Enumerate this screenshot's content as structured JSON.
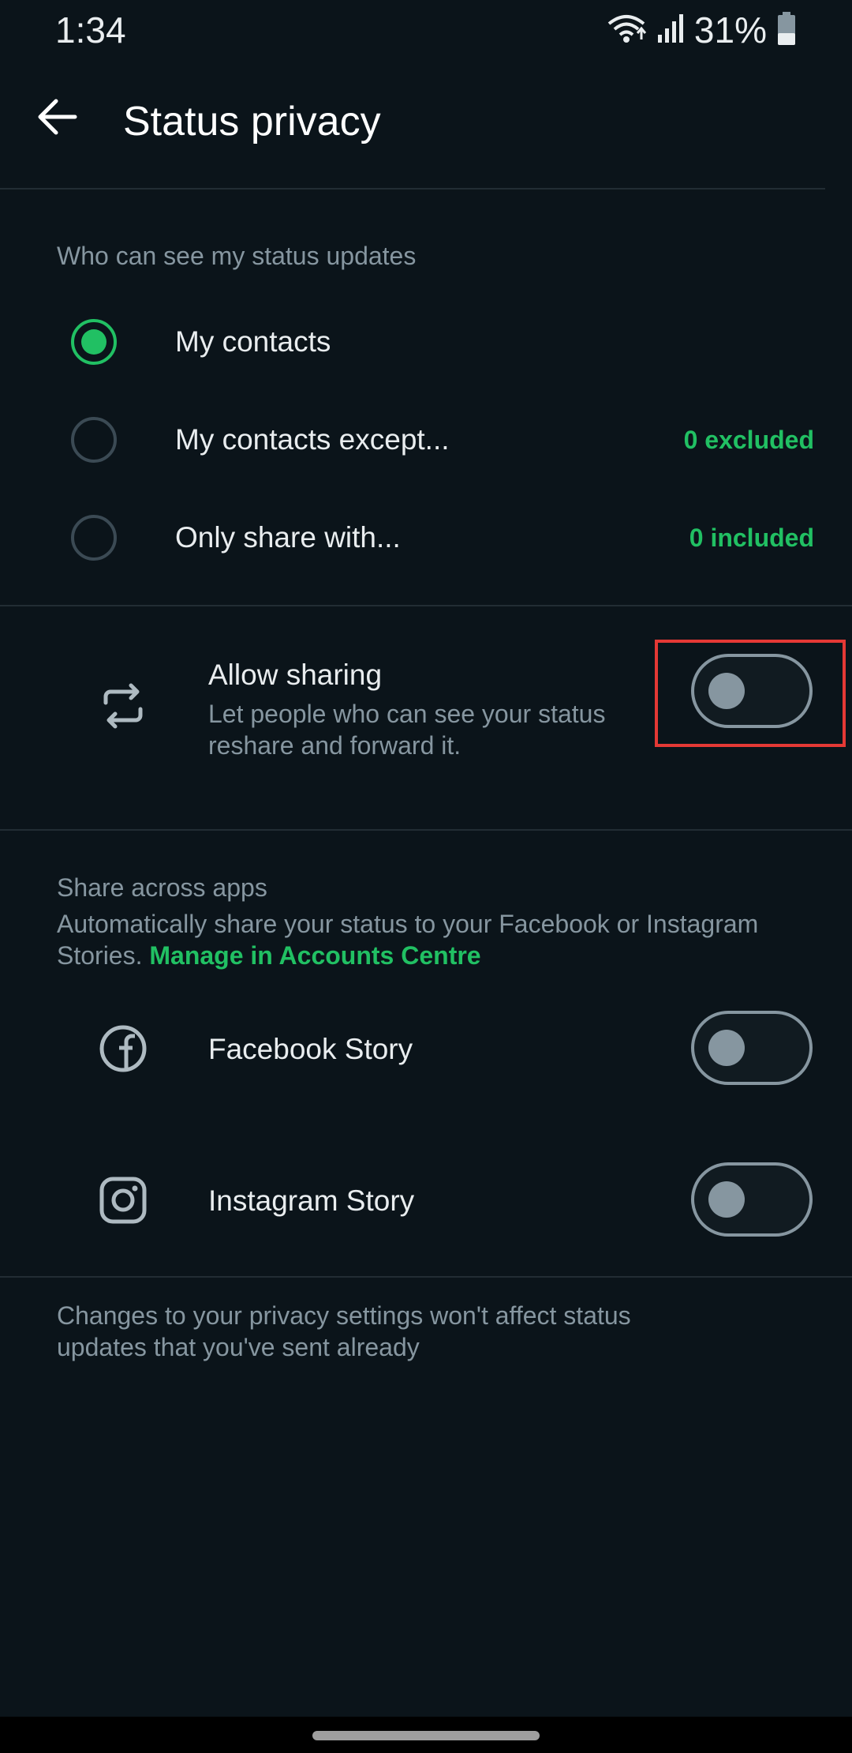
{
  "status_bar": {
    "time": "1:34",
    "battery_pct": "31%",
    "icons": [
      "wifi-icon",
      "signal-icon",
      "battery-icon"
    ]
  },
  "app_bar": {
    "title": "Status privacy",
    "back_icon": "arrow-left-icon"
  },
  "audience": {
    "section_title": "Who can see my status updates",
    "options": [
      {
        "label": "My contacts",
        "count": "",
        "selected": true
      },
      {
        "label": "My contacts except...",
        "count": "0 excluded",
        "selected": false
      },
      {
        "label": "Only share with...",
        "count": "0 included",
        "selected": false
      }
    ]
  },
  "allow_sharing": {
    "icon": "repeat-icon",
    "title": "Allow sharing",
    "subtitle_line1": "Let people who can see your status",
    "subtitle_line2": "reshare and forward it.",
    "enabled": false
  },
  "share_across_apps": {
    "section_title": "Share across apps",
    "desc_line1": "Automatically share your status to your Facebook or Instagram",
    "desc_line2": "Stories.",
    "link": "Manage in Accounts Centre",
    "items": [
      {
        "icon": "facebook-icon",
        "label": "Facebook Story",
        "enabled": false
      },
      {
        "icon": "instagram-icon",
        "label": "Instagram Story",
        "enabled": false
      }
    ]
  },
  "footer": {
    "note_line1": "Changes to your privacy settings won't affect status",
    "note_line2": "updates that you've sent already"
  },
  "colors": {
    "background": "#0b141a",
    "accent": "#21c063",
    "muted": "#8696a0",
    "highlight": "#e53935"
  }
}
